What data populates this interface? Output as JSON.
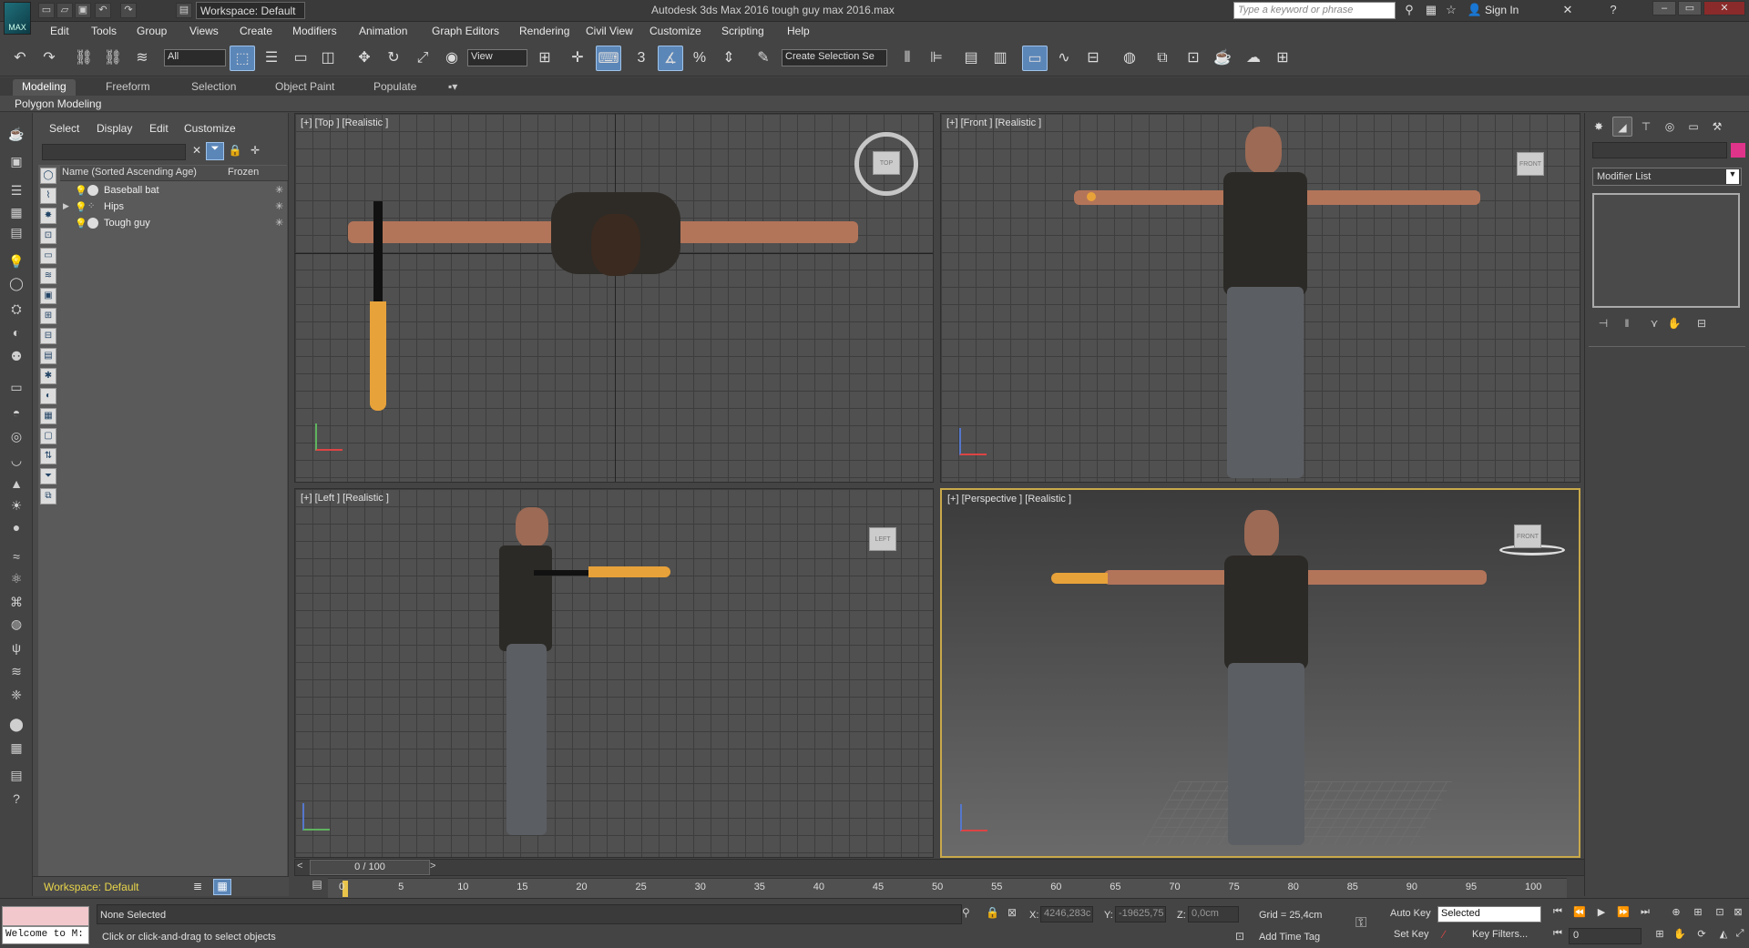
{
  "titlebar": {
    "logo_text": "MAX",
    "workspace": "Workspace: Default",
    "app_title": "Autodesk 3ds Max 2016      tough guy max 2016.max",
    "search_placeholder": "Type a keyword or phrase",
    "sign_in": "Sign In"
  },
  "menubar": {
    "items": [
      "Edit",
      "Tools",
      "Group",
      "Views",
      "Create",
      "Modifiers",
      "Animation",
      "Graph Editors",
      "Rendering",
      "Civil View",
      "Customize",
      "Scripting",
      "Help"
    ]
  },
  "toolbar": {
    "filter_value": "All",
    "ref_coord_value": "View",
    "snap_value": "3",
    "selection_set_placeholder": "Create Selection Se"
  },
  "ribbon": {
    "tabs": [
      "Modeling",
      "Freeform",
      "Selection",
      "Object Paint",
      "Populate"
    ],
    "panel_label": "Polygon Modeling"
  },
  "explorer": {
    "menus": [
      "Select",
      "Display",
      "Edit",
      "Customize"
    ],
    "col_name": "Name (Sorted Ascending Age)",
    "col_frozen": "Frozen",
    "rows": [
      {
        "name": "Baseball bat"
      },
      {
        "name": "Hips"
      },
      {
        "name": "Tough guy"
      }
    ],
    "footer_workspace": "Workspace: Default"
  },
  "viewports": {
    "top": {
      "label": "[+] [Top ] [Realistic ]",
      "cube": "TOP"
    },
    "front": {
      "label": "[+] [Front ] [Realistic ]",
      "cube": "FRONT"
    },
    "left": {
      "label": "[+] [Left ] [Realistic ]",
      "cube": "LEFT"
    },
    "perspective": {
      "label": "[+] [Perspective ] [Realistic ]",
      "cube": "FRONT"
    }
  },
  "timeline": {
    "slider_text": "0 / 100",
    "ticks": [
      "0",
      "5",
      "10",
      "15",
      "20",
      "25",
      "30",
      "35",
      "40",
      "45",
      "50",
      "55",
      "60",
      "65",
      "70",
      "75",
      "80",
      "85",
      "90",
      "95",
      "100"
    ]
  },
  "status": {
    "maxscript": "Welcome to M:",
    "selection": "None Selected",
    "prompt": "Click or click-and-drag to select objects",
    "x_label": "X:",
    "x_value": "4246,283c",
    "y_label": "Y:",
    "y_value": "-19625,75",
    "z_label": "Z:",
    "z_value": "0,0cm",
    "grid": "Grid = 25,4cm",
    "add_time_tag": "Add Time Tag",
    "auto_key": "Auto Key",
    "set_key": "Set Key",
    "selected": "Selected",
    "key_filters": "Key Filters...",
    "frame": "0"
  },
  "cmdpanel": {
    "modifier_list": "Modifier List"
  },
  "colors": {
    "accent_blue": "#5b86b8",
    "perspective_border": "#c8a94a",
    "object_color": "#e0338a"
  }
}
